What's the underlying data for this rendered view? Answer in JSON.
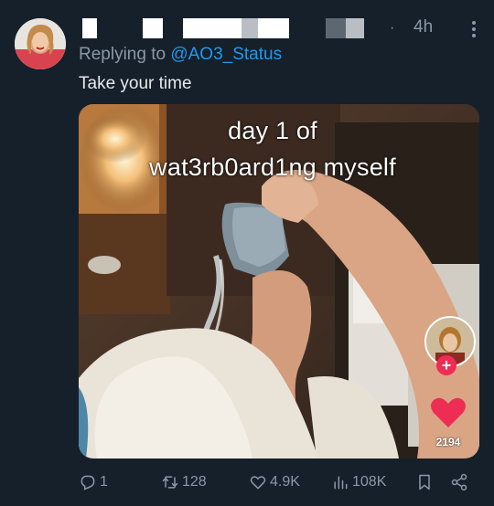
{
  "tweet": {
    "time_separator": "·",
    "time": "4h",
    "replying_prefix": "Replying to",
    "replying_handle": "@AO3_Status",
    "text": "Take your time"
  },
  "media": {
    "caption_line1": "day 1 of",
    "caption_line2": "wat3rb0ard1ng myself",
    "like_count": "2194",
    "follow_symbol": "+"
  },
  "actions": {
    "replies": "1",
    "retweets": "128",
    "likes": "4.9K",
    "views": "108K"
  },
  "colors": {
    "background": "#15202b",
    "secondary_text": "#8b98a5",
    "link": "#1d9bf0",
    "tiktok_red": "#ee2d55"
  },
  "icons": [
    "more-icon",
    "reply-icon",
    "retweet-icon",
    "like-icon",
    "views-icon",
    "bookmark-icon",
    "share-icon",
    "tiktok-heart-icon"
  ]
}
